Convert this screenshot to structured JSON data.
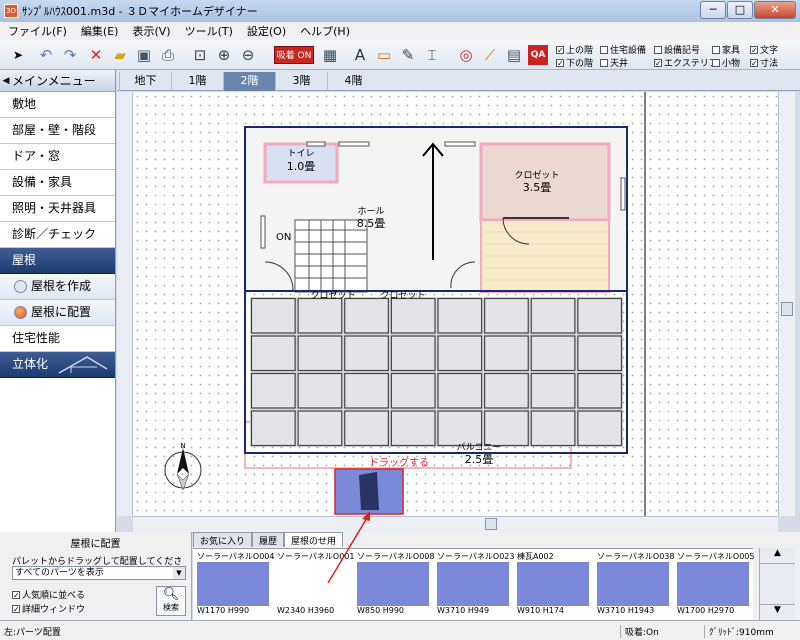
{
  "window": {
    "title": "ｻﾝﾌﾟﾙﾊｳｽ001.m3d - ３Ｄマイホームデザイナー",
    "app_icon": "3D",
    "controls": {
      "minimize": "─",
      "maximize": "□",
      "close": "✕"
    }
  },
  "menu": [
    "ファイル(F)",
    "編集(E)",
    "表示(V)",
    "ツール(T)",
    "設定(O)",
    "ヘルプ(H)"
  ],
  "toolbar": {
    "adsorb_button": "吸着 ON",
    "icon_text": "QA",
    "check_col1": [
      {
        "label": "上の階",
        "checked": true
      },
      {
        "label": "下の階",
        "checked": true
      }
    ],
    "check_col2": [
      {
        "label": "住宅設備",
        "checked": false
      },
      {
        "label": "天井",
        "checked": false
      }
    ],
    "check_col3": [
      {
        "label": "設備記号",
        "checked": false
      },
      {
        "label": "エクステリア",
        "checked": true
      }
    ],
    "check_col4": [
      {
        "label": "家具",
        "checked": false
      },
      {
        "label": "小物",
        "checked": false
      }
    ],
    "check_col5": [
      {
        "label": "文字",
        "checked": true
      },
      {
        "label": "寸法",
        "checked": true
      }
    ]
  },
  "left_panel": {
    "header": "メインメニュー",
    "items": [
      "敷地",
      "部屋・壁・階段",
      "ドア・窓",
      "設備・家具",
      "照明・天井器具",
      "診断／チェック"
    ],
    "roof_section": "屋根",
    "roof_sub": [
      "屋根を作成",
      "屋根に配置"
    ],
    "performance": "住宅性能",
    "solid": "立体化"
  },
  "floor_tabs": {
    "labels": [
      "地下",
      "1階",
      "2階",
      "3階",
      "4階"
    ],
    "active": 2
  },
  "floorplan": {
    "rooms": [
      {
        "name": "トイレ",
        "size": "1.0畳"
      },
      {
        "name": "ホール",
        "size": "8.5畳"
      },
      {
        "name": "クロゼット",
        "size": "3.5畳"
      },
      {
        "name": "クロゼット",
        "size": ""
      },
      {
        "name": "クロゼット",
        "size": ""
      },
      {
        "name": "バルコニー",
        "size": "2.5畳"
      }
    ],
    "on_label": "ON",
    "compass_label": "N",
    "drag_label": "ドラッグする",
    "panel_rows": 4,
    "panel_cols": 8
  },
  "bottom_left": {
    "title": "屋根に配置",
    "instruction": "パレットからドラッグして配置してください。",
    "dropdown": "すべてのパーツを表示",
    "checks": [
      {
        "label": "人気順に並べる",
        "checked": true
      },
      {
        "label": "詳細ウィンドウ",
        "checked": true
      }
    ],
    "search_button": "検索"
  },
  "bottom_tabs": [
    "お気に入り",
    "履歴",
    "屋根のせ用"
  ],
  "parts": [
    {
      "name": "ソーラーパネルO004",
      "size": "W1170 H990",
      "color": "#7b89d8"
    },
    {
      "name": "ソーラーパネルO001",
      "size": "W2340 H3960",
      "color": "#ffffff"
    },
    {
      "name": "ソーラーパネルO008",
      "size": "W850 H990",
      "color": "#7b89d8"
    },
    {
      "name": "ソーラーパネルO023",
      "size": "W3710 H949",
      "color": "#7b89d8"
    },
    {
      "name": "棟瓦A002",
      "size": "W910 H174",
      "color": "#7b89d8"
    },
    {
      "name": "ソーラーパネルO038",
      "size": "W3710 H1943",
      "color": "#7b89d8"
    },
    {
      "name": "ソーラーパネルO005",
      "size": "W1700 H2970",
      "color": "#7b89d8"
    }
  ],
  "status": {
    "left": "左:パーツ配置",
    "snap": "吸着:On",
    "grid": "ｸﾞﾘｯﾄﾞ:910mm"
  }
}
